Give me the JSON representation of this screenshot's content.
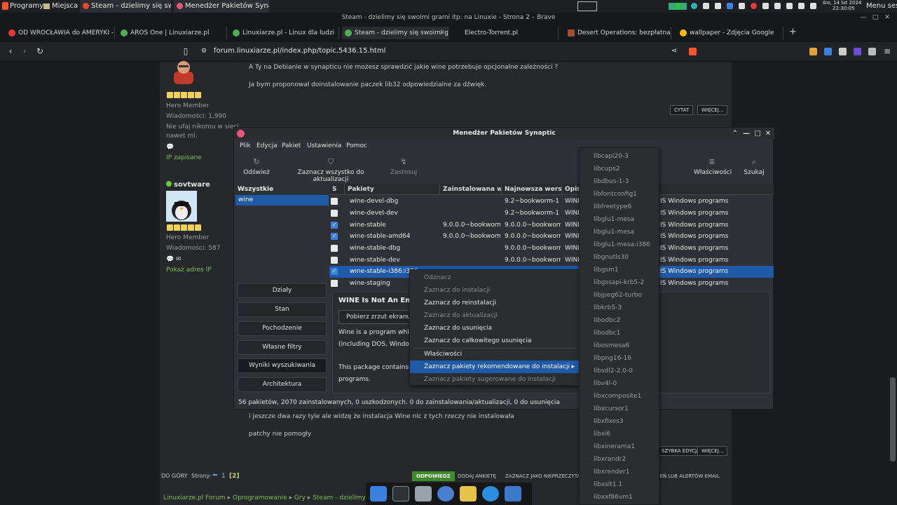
{
  "panel": {
    "programs": "Programy",
    "places": "Miejsca",
    "tasks": [
      {
        "label": "Steam - dzielimy się swoi...",
        "color": "#e94b2a"
      },
      {
        "label": "Menedżer Pakietów Syna...",
        "color": "#e8577a"
      }
    ],
    "date": "śro, 14 lut 2024",
    "time": "22:30:05",
    "session": "Menu sesji"
  },
  "browser": {
    "window_title": "Steam - dzielimy się swoimi grami itp: na Linuxie - Strona 2 – Brave",
    "tabs": [
      {
        "label": "OD WROCŁAWIA do AMERYKI - K",
        "color": "#e53935"
      },
      {
        "label": "AROS One | Linuxiarze.pl",
        "color": "#4caf50"
      },
      {
        "label": "Linuxiarze.pl - Linux dla ludzi",
        "color": "#4caf50"
      },
      {
        "label": "Steam - dzielimy się swoimi g",
        "color": "#4caf50"
      },
      {
        "label": "Electro-Torrent.pl",
        "color": "#888888"
      },
      {
        "label": "Desert Operations: bezpłatna st",
        "color": "#a0522d"
      },
      {
        "label": "wallpaper - Zdjęcia Google",
        "color": "#fbbc04"
      }
    ],
    "url": "forum.linuxiarze.pl/index.php/topic,5436.15.html"
  },
  "forum": {
    "post1_line1": "A Ty na Debianie w synapticu nie możesz sprawdzić jakie wine potrzebuje opcjonalne zależności ?",
    "post1_line2": "Ja bym proponował doinstalowanie paczek lib32 odpowiedzialne za dźwięk.",
    "quote_btn": "CYTAT",
    "more_btn": "WIĘCEJ...",
    "user1_rank": "Hero Member",
    "user1_posts": "Wiadomości: 1,990",
    "user1_sig1": "Nie ufaj nikomu w sieci",
    "user1_sig2": "nawet mi.",
    "user1_ip": "IP zapisane",
    "user2_name": "sovtware",
    "user2_rank": "Hero Member",
    "user2_posts": "Wiadomości: 587",
    "user2_ip": "Pokaż adres IP",
    "post2_line1": "i jeszcze dwa razy tyle ale widzę że instalacja Wine nic z tych rzeczy nie instalowała",
    "post2_line2": "patchy nie pomogły",
    "quick_edit_btn": "SZYBKA EDYCJA",
    "more_btn2": "WIĘCEJ...",
    "top_link": "DO GÓRY",
    "pages_label": "Strony:",
    "page1": "1",
    "page2": "[2]",
    "reply_btn": "ODPOWIEDZ",
    "add_poll": "DODAJ ANKIETĘ",
    "mark_unread": "ZAZNACZ JAKO NIEPRZECZYTA",
    "alerts": "OMIEŃ LUB ALERTÓW EMAIL",
    "crumbs": [
      "Linuxiarze.pl Forum",
      "Oprogramowanie",
      "Gry",
      "Steam - dzielimy się swoi"
    ]
  },
  "synaptic": {
    "title": "Menedżer Pakietów Synaptic",
    "menu": [
      "Plik",
      "Edycja",
      "Pakiet",
      "Ustawienia",
      "Pomoc"
    ],
    "toolbar": {
      "reload": "Odśwież",
      "mark_all": "Zaznacz wszystko do aktualizacji",
      "apply": "Zastosuj",
      "properties": "Właściwości",
      "search": "Szukaj"
    },
    "filter_header": "Wszystkie",
    "filter_item": "wine",
    "side_buttons": [
      "Działy",
      "Stan",
      "Pochodzenie",
      "Własne filtry",
      "Wyniki wyszukiwania",
      "Architektura"
    ],
    "columns": [
      "S",
      "Pakiety",
      "Zainstalowana wer",
      "Najnowsza wersja",
      "Opis"
    ],
    "packages": [
      {
        "name": "wine-devel-dbg",
        "installed": "",
        "latest": "9.2~bookworm-1",
        "desc": "WINE",
        "desc2": "IS Windows programs",
        "checked": false
      },
      {
        "name": "wine-devel-dev",
        "installed": "",
        "latest": "9.2~bookworm-1",
        "desc": "WINE",
        "desc2": "IS Windows programs",
        "checked": false
      },
      {
        "name": "wine-stable",
        "installed": "9.0.0.0~bookworm-",
        "latest": "9.0.0.0~bookworm-",
        "desc": "WINE",
        "desc2": "IS Windows programs",
        "checked": true
      },
      {
        "name": "wine-stable-amd64",
        "installed": "9.0.0.0~bookworm-",
        "latest": "9.0.0.0~bookworm-",
        "desc": "WINE",
        "desc2": "IS Windows programs",
        "checked": true
      },
      {
        "name": "wine-stable-dbg",
        "installed": "",
        "latest": "9.0.0.0~bookworm-",
        "desc": "WINE",
        "desc2": "IS Windows programs",
        "checked": false
      },
      {
        "name": "wine-stable-dev",
        "installed": "",
        "latest": "9.0.0.0~bookworm-",
        "desc": "WINE",
        "desc2": "IS Windows programs",
        "checked": false
      },
      {
        "name": "wine-stable-i386:i386",
        "installed": "",
        "latest": "",
        "desc": "",
        "desc2": "IS Windows programs",
        "checked": true
      },
      {
        "name": "wine-staging",
        "installed": "",
        "latest": "",
        "desc": "",
        "desc2": "IS Windows programs",
        "checked": false
      }
    ],
    "desc_title": "WINE Is Not An Emul",
    "screenshot_btn": "Pobierz zrzut ekranu",
    "desc_l1": "Wine is a program which a",
    "desc_l2": "(including DOS, Windows",
    "desc_l3": "This package contains the",
    "desc_l4": "programs.",
    "status": "56 pakietów, 2070 zainstalowanych, 0 uszkodzonych. 0 do zainstalowania/aktualizacji, 0 do usunięcia"
  },
  "context_menu": [
    {
      "label": "Odznacz",
      "disabled": true
    },
    {
      "label": "Zaznacz do instalacji",
      "disabled": true
    },
    {
      "label": "Zaznacz do reinstalacji",
      "disabled": false
    },
    {
      "label": "Zaznacz do aktualizacji",
      "disabled": true
    },
    {
      "label": "Zaznacz do usunięcia",
      "disabled": false
    },
    {
      "label": "Zaznacz do całkowitego usunięcia",
      "disabled": false
    },
    {
      "label": "Właściwości",
      "disabled": false
    },
    {
      "label": "Zaznacz pakiety rekomendowane do instalacji",
      "disabled": false
    },
    {
      "label": "Zaznacz pakiety sugerowane do instalacji",
      "disabled": true
    }
  ],
  "submenu": [
    "libcapi20-3",
    "libcups2",
    "libdbus-1-3",
    "libfontconfig1",
    "libfreetype6",
    "libglu1-mesa",
    "libglu1-mesa",
    "libglu1-mesa:i386",
    "libgnutls30",
    "libgsm1",
    "libgssapi-krb5-2",
    "libjpeg62-turbo",
    "libkrb5-3",
    "libodbc2",
    "libodbc1",
    "libosmesa6",
    "libpng16-16",
    "libsdl2-2.0-0",
    "libv4l-0",
    "libxcomposite1",
    "libxcursor1",
    "libxfixes3",
    "libxi6",
    "libxinerama1",
    "libxrandr2",
    "libxrender1",
    "libxslt1.1",
    "libxxf86vm1"
  ]
}
